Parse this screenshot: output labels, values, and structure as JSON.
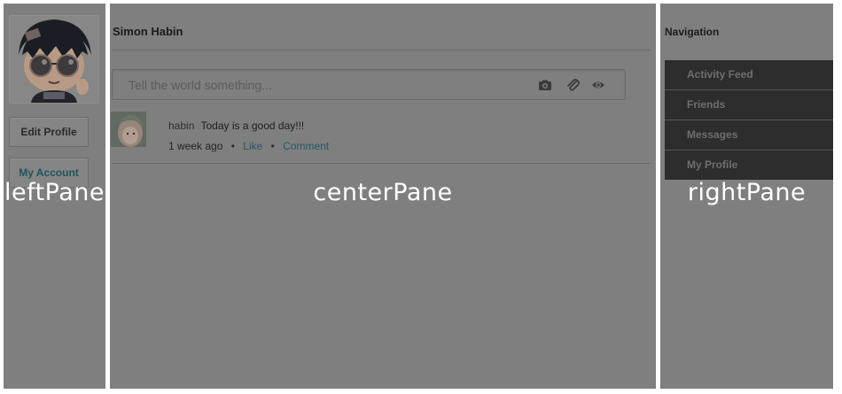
{
  "labels": {
    "left": "leftPane",
    "center": "centerPane",
    "right": "rightPane"
  },
  "left": {
    "edit_profile": "Edit Profile",
    "my_account": "My Account"
  },
  "center": {
    "profile_name": "Simon Habin",
    "status_placeholder": "Tell the world something...",
    "post": {
      "author": "habin",
      "text": "Today is a good day!!!",
      "time": "1 week ago",
      "separator": "•",
      "like": "Like",
      "comment": "Comment"
    }
  },
  "right": {
    "title": "Navigation",
    "items": [
      "Activity Feed",
      "Friends",
      "Messages",
      "My Profile"
    ]
  },
  "colors": {
    "pane_gray": "#7f7f7f",
    "nav_bg": "#2d2d2d",
    "link": "#1f5a66"
  },
  "icons": [
    "camera-icon",
    "paperclip-icon",
    "eye-icon"
  ]
}
